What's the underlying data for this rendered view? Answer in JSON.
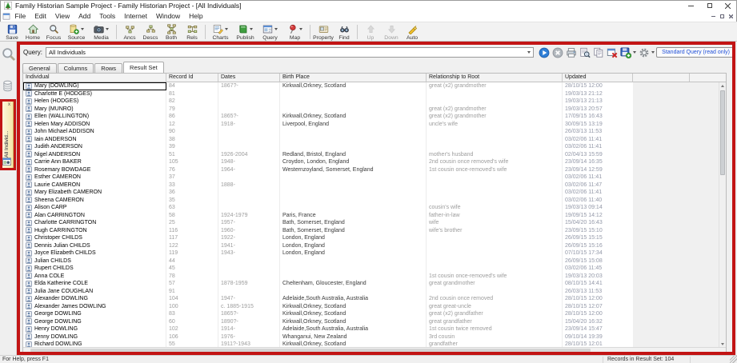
{
  "window": {
    "title": "Family Historian Sample Project - Family Historian Project - [All Individuals]",
    "menus": [
      "File",
      "Edit",
      "View",
      "Add",
      "Tools",
      "Internet",
      "Window",
      "Help"
    ]
  },
  "toolbar": {
    "groups": [
      {
        "buttons": [
          {
            "label": "Save",
            "icon": "save"
          },
          {
            "label": "Home",
            "icon": "home"
          },
          {
            "label": "Focus",
            "icon": "focus"
          },
          {
            "label": "Source",
            "icon": "source",
            "dropdown": true
          },
          {
            "label": "Media",
            "icon": "media",
            "dropdown": true
          }
        ]
      },
      {
        "buttons": [
          {
            "label": "Ancs",
            "icon": "ancs"
          },
          {
            "label": "Descs",
            "icon": "descs"
          },
          {
            "label": "Both",
            "icon": "both"
          },
          {
            "label": "Rels",
            "icon": "rels"
          }
        ]
      },
      {
        "buttons": [
          {
            "label": "Charts",
            "icon": "charts",
            "dropdown": true
          },
          {
            "label": "Publish",
            "icon": "publish",
            "dropdown": true
          },
          {
            "label": "Query",
            "icon": "query",
            "dropdown": true
          },
          {
            "label": "Map",
            "icon": "map",
            "dropdown": true
          }
        ]
      },
      {
        "buttons": [
          {
            "label": "Property",
            "icon": "property"
          },
          {
            "label": "Find",
            "icon": "find"
          }
        ]
      },
      {
        "buttons": [
          {
            "label": "Up",
            "icon": "up",
            "disabled": true
          },
          {
            "label": "Down",
            "icon": "down",
            "disabled": true
          },
          {
            "label": "Auto",
            "icon": "auto"
          }
        ]
      }
    ]
  },
  "sidebar": {
    "tab_label": "All Individ...",
    "tab_close": "x"
  },
  "query_bar": {
    "label": "Query:",
    "value": "All Individuals",
    "buttons": [
      {
        "icon": "run"
      },
      {
        "icon": "stop"
      },
      {
        "icon": "print"
      },
      {
        "icon": "preview"
      },
      {
        "icon": "copy"
      },
      {
        "icon": "close-query"
      },
      {
        "icon": "save-query",
        "dropdown": true
      },
      {
        "icon": "options",
        "dropdown": true
      }
    ],
    "mode_button": "Standard Query (read only)"
  },
  "tabs": {
    "items": [
      "General",
      "Columns",
      "Rows",
      "Result Set"
    ],
    "active": "Result Set"
  },
  "table": {
    "columns": [
      "Individual",
      "Record Id",
      "Dates",
      "Birth Place",
      "Relationship to Root",
      "Updated"
    ],
    "rows": [
      [
        "Mary (DOWLING)",
        "84",
        "1867?-",
        "Kirkwall,Orkney, Scotland",
        "great (x2) grandmother",
        "28/10/15 12:00"
      ],
      [
        "Charlotte E (HODGES)",
        "81",
        "",
        "",
        "",
        "19/03/13 21:12"
      ],
      [
        "Helen (HODGES)",
        "82",
        "",
        "",
        "",
        "19/03/13 21:13"
      ],
      [
        "Mary (MUNRO)",
        "79",
        "",
        "",
        "great (x2) grandmother",
        "19/03/13 20:57"
      ],
      [
        "Ellen (WALLINGTON)",
        "86",
        "1865?-",
        "Kirkwall,Orkney, Scotland",
        "great (x2) grandmother",
        "17/09/15 16:43"
      ],
      [
        "Helen Mary ADDISON",
        "12",
        "1918-",
        "Liverpool, England",
        "uncle's wife",
        "30/09/15 13:19"
      ],
      [
        "John Michael ADDISON",
        "90",
        "",
        "",
        "",
        "26/03/13 11:53"
      ],
      [
        "Iain ANDERSON",
        "38",
        "",
        "",
        "",
        "03/02/06 11:41"
      ],
      [
        "Judith ANDERSON",
        "39",
        "",
        "",
        "",
        "03/02/06 11:41"
      ],
      [
        "Nigel ANDERSON",
        "51",
        "1926-2004",
        "Redland, Bristol, England",
        "mother's husband",
        "02/04/13 15:59"
      ],
      [
        "Carrie Ann BAKER",
        "105",
        "1948-",
        "Croydon, London, England",
        "2nd cousin once removed's wife",
        "23/09/14 16:35"
      ],
      [
        "Rosemary BOWDAGE",
        "76",
        "1964-",
        "Westernzoyland, Somerset, England",
        "1st cousin once-removed's wife",
        "23/09/14 12:59"
      ],
      [
        "Esther CAMERON",
        "37",
        "",
        "",
        "",
        "03/02/06 11:41"
      ],
      [
        "Laurie CAMERON",
        "33",
        "1888-",
        "",
        "",
        "03/02/06 11:47"
      ],
      [
        "Mary Elizabeth CAMERON",
        "36",
        "",
        "",
        "",
        "03/02/06 11:41"
      ],
      [
        "Sheena CAMERON",
        "35",
        "",
        "",
        "",
        "03/02/06 11:40"
      ],
      [
        "Alison CARP",
        "63",
        "",
        "",
        "cousin's wife",
        "19/03/13 09:14"
      ],
      [
        "Alan CARRINGTON",
        "58",
        "1924-1979",
        "Paris, France",
        "father-in-law",
        "19/09/15 14:12"
      ],
      [
        "Charlotte CARRINGTON",
        "25",
        "1957-",
        "Bath, Somerset, England",
        "wife",
        "15/04/20 16:43"
      ],
      [
        "Hugh CARRINGTON",
        "116",
        "1960-",
        "Bath, Somerset, England",
        "wife's brother",
        "23/09/15 15:10"
      ],
      [
        "Christoper CHILDS",
        "117",
        "1922-",
        "London, England",
        "",
        "26/09/15 15:15"
      ],
      [
        "Dennis Julian CHILDS",
        "122",
        "1941-",
        "London, England",
        "",
        "26/09/15 15:16"
      ],
      [
        "Joyce Elizabeth CHILDS",
        "119",
        "1943-",
        "London, England",
        "",
        "07/10/15 17:34"
      ],
      [
        "Julian CHILDS",
        "44",
        "",
        "",
        "",
        "26/09/15 15:08"
      ],
      [
        "Rupert CHILDS",
        "45",
        "",
        "",
        "",
        "03/02/06 11:45"
      ],
      [
        "Anna COLE",
        "78",
        "",
        "",
        "1st cousin once-removed's wife",
        "19/03/13 20:03"
      ],
      [
        "Elda Katherine COLE",
        "57",
        "1878-1959",
        "Cheltenham, Gloucester, England",
        "great grandmother",
        "08/10/15 14:41"
      ],
      [
        "Julia Jane COUGHLAN",
        "91",
        "",
        "",
        "",
        "26/03/13 11:53"
      ],
      [
        "Alexander DOWLING",
        "104",
        "1947-",
        "Adelaide,South Australia, Australia",
        "2nd cousin once removed",
        "28/10/15 12:00"
      ],
      [
        "Alexander James DOWLING",
        "100",
        "c. 1885-1915",
        "Kirkwall,Orkney, Scotland",
        "great great-uncle",
        "28/10/15 12:07"
      ],
      [
        "George DOWLING",
        "83",
        "1865?-",
        "Kirkwall,Orkney, Scotland",
        "great (x2) grandfather",
        "28/10/15 12:00"
      ],
      [
        "George DOWLING",
        "60",
        "1890?-",
        "Kirkwall,Orkney, Scotland",
        "great grandfather",
        "15/04/20 16:32"
      ],
      [
        "Henry DOWLING",
        "102",
        "1914-",
        "Adelaide,South Australia, Australia",
        "1st cousin twice removed",
        "23/09/14 15:47"
      ],
      [
        "Jenny DOWLING",
        "106",
        "1976-",
        "Whanganui, New Zealand",
        "3rd cousin",
        "09/10/14 19:39"
      ],
      [
        "Richard DOWLING",
        "55",
        "1911?-1943",
        "Kirkwall,Orkney, Scotland",
        "grandfather",
        "28/10/15 12:01"
      ]
    ]
  },
  "status_bar": {
    "left": "For Help, press F1",
    "records": "Records in Result Set: 104"
  }
}
